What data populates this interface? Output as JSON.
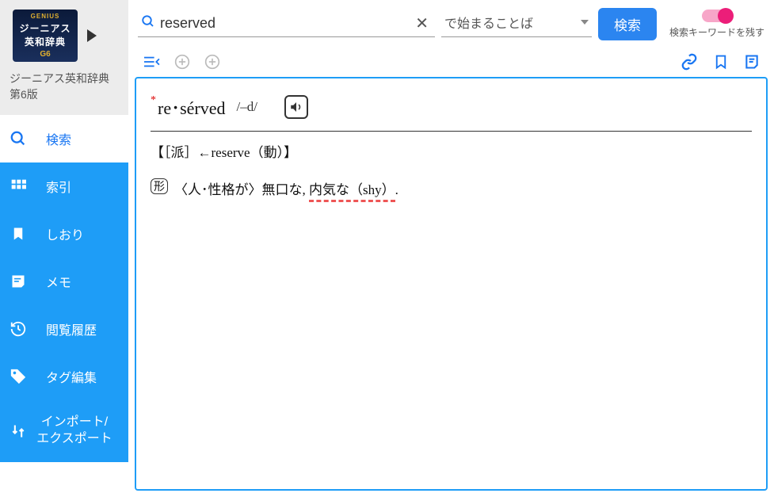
{
  "logo": {
    "genius": "GENIUS",
    "line1": "ジーニアス",
    "line2": "英和辞典",
    "edition": "G6"
  },
  "dict_title": "ジーニアス英和辞典 第6版",
  "sidebar": {
    "items": [
      {
        "label": "検索"
      },
      {
        "label": "索引"
      },
      {
        "label": "しおり"
      },
      {
        "label": "メモ"
      },
      {
        "label": "閲覧履歴"
      },
      {
        "label": "タグ編集"
      },
      {
        "label": "インポート/\nエクスポート"
      }
    ]
  },
  "search": {
    "value": "reserved",
    "filter": "で始まることば",
    "button": "検索",
    "toggle_label": "検索キーワードを残す"
  },
  "entry": {
    "headword": "re･sérved",
    "pronunciation": "/–d/",
    "etymology": "【［派］←reserve（動）】",
    "pos": "形",
    "definition_prefix": "〈人･性格が〉無口な, ",
    "definition_underlined": "内気な（shy）",
    "definition_suffix": "."
  }
}
